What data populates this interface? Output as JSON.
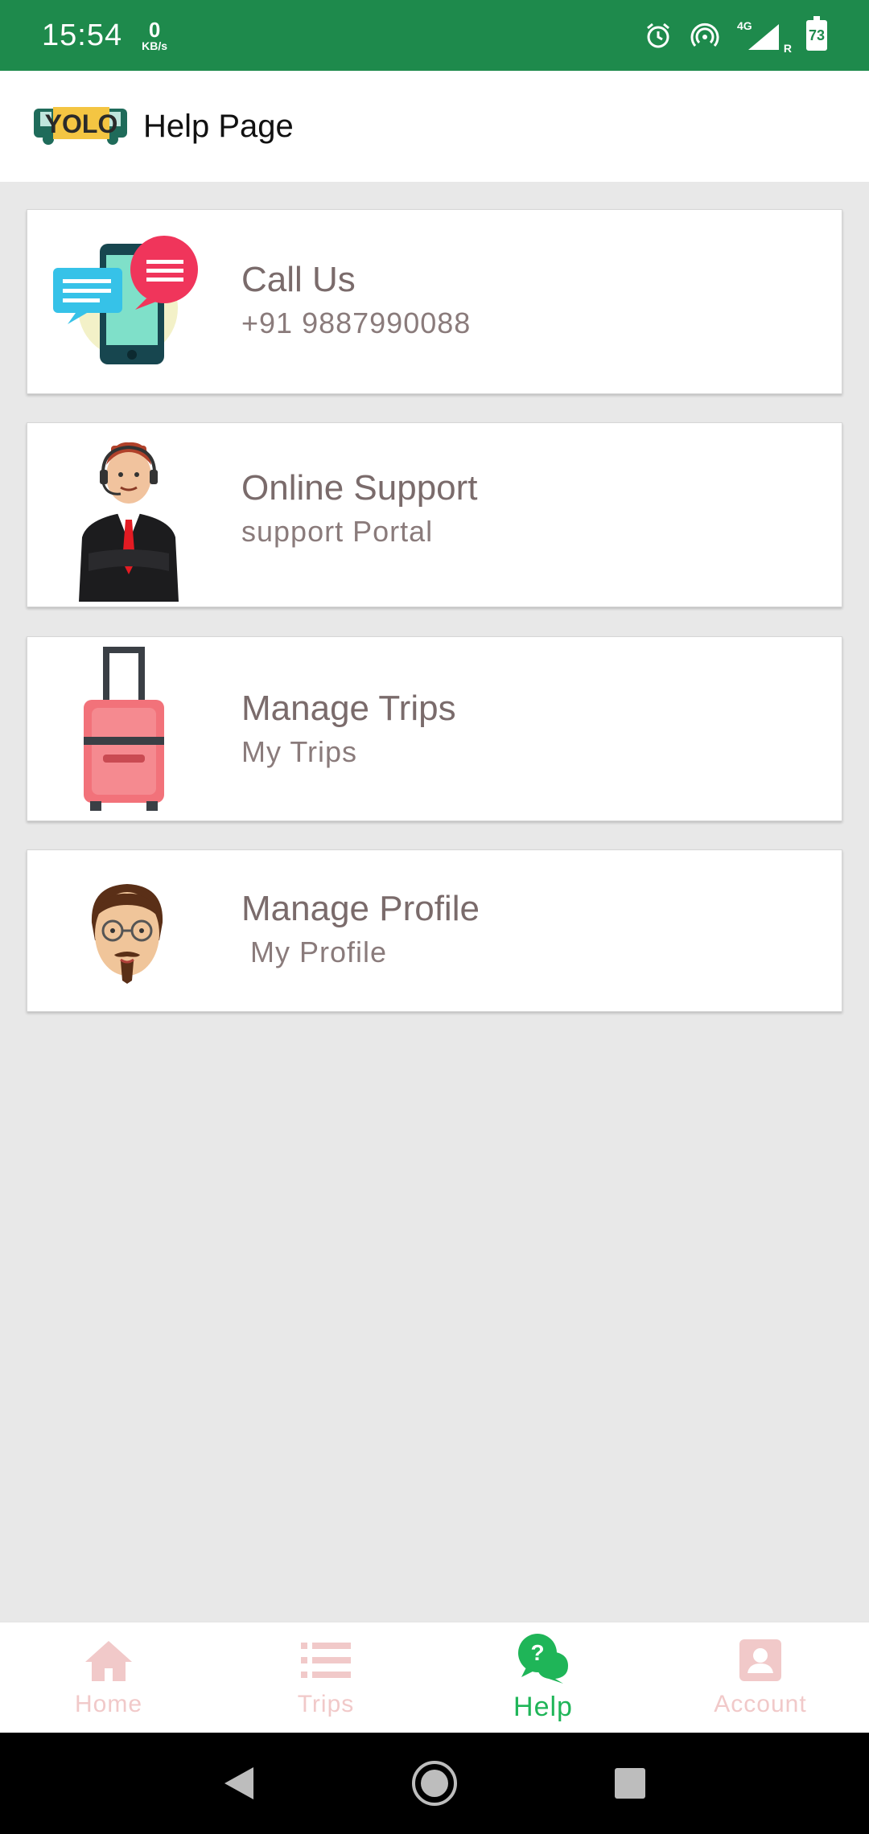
{
  "status_bar": {
    "time": "15:54",
    "speed_value": "0",
    "speed_unit": "KB/s",
    "network": "4G",
    "roaming": "R",
    "battery": "73"
  },
  "app_bar": {
    "title": "Help Page",
    "logo_text": "YOLO"
  },
  "cards": [
    {
      "title": "Call Us",
      "subtitle": "+91 9887990088",
      "icon": "phone-chat-illustration"
    },
    {
      "title": "Online Support",
      "subtitle": "support Portal",
      "icon": "support-agent-illustration"
    },
    {
      "title": "Manage Trips",
      "subtitle": "My Trips",
      "icon": "suitcase-illustration"
    },
    {
      "title": "Manage Profile",
      "subtitle": " My Profile",
      "icon": "profile-avatar-illustration"
    }
  ],
  "bottom_nav": {
    "items": [
      {
        "label": "Home",
        "icon": "home-icon",
        "active": false
      },
      {
        "label": "Trips",
        "icon": "list-icon",
        "active": false
      },
      {
        "label": "Help",
        "icon": "help-chat-icon",
        "active": true
      },
      {
        "label": "Account",
        "icon": "account-icon",
        "active": false
      }
    ]
  },
  "colors": {
    "status_bar": "#1e8a4c",
    "accent_active": "#1fb558",
    "inactive_nav": "#f1c9c9",
    "card_text": "#7a6b6b",
    "background": "#e8e8e8"
  }
}
